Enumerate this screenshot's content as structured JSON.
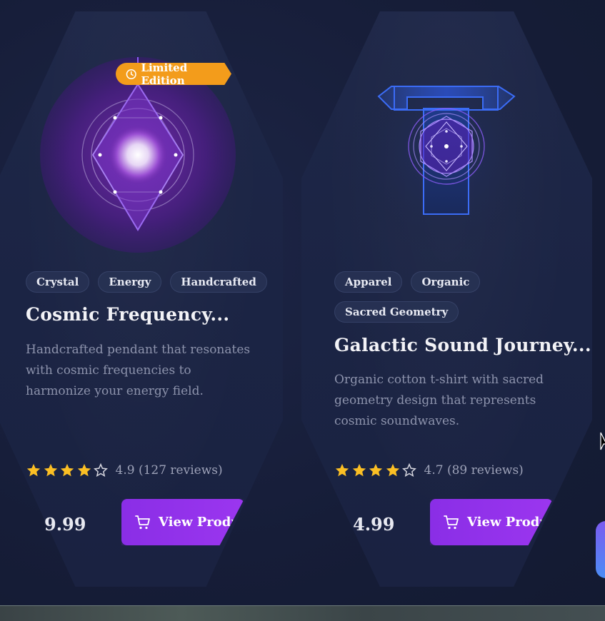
{
  "products": [
    {
      "badge": "Limited Edition",
      "tags": [
        "Crystal",
        "Energy",
        "Handcrafted"
      ],
      "title": "Cosmic Frequency...",
      "description": "Handcrafted pendant that resonates with cosmic frequencies to harmonize your energy field.",
      "rating_value": 4.9,
      "rating_text": "4.9 (127 reviews)",
      "stars_filled": 4,
      "price": "9.99",
      "button_label": "View Produc"
    },
    {
      "tags": [
        "Apparel",
        "Organic",
        "Sacred Geometry"
      ],
      "title": "Galactic Sound Journey...",
      "description": "Organic cotton t-shirt with sacred geometry design that represents cosmic soundwaves.",
      "rating_value": 4.7,
      "rating_text": "4.7 (89 reviews)",
      "stars_filled": 4,
      "price": "4.99",
      "button_label": "View Produc"
    }
  ],
  "icons": {
    "badge": "clock-icon",
    "button": "cart-icon",
    "star_filled": "star-filled-icon",
    "star_empty": "star-outline-icon"
  },
  "colors": {
    "background": "#161d38",
    "card": "#1d2646",
    "badge": "#f39c1b",
    "button": "#9333ea",
    "star": "#fbbf24",
    "accent_purple": "#8b5cf6",
    "accent_blue": "#3b82f6"
  }
}
